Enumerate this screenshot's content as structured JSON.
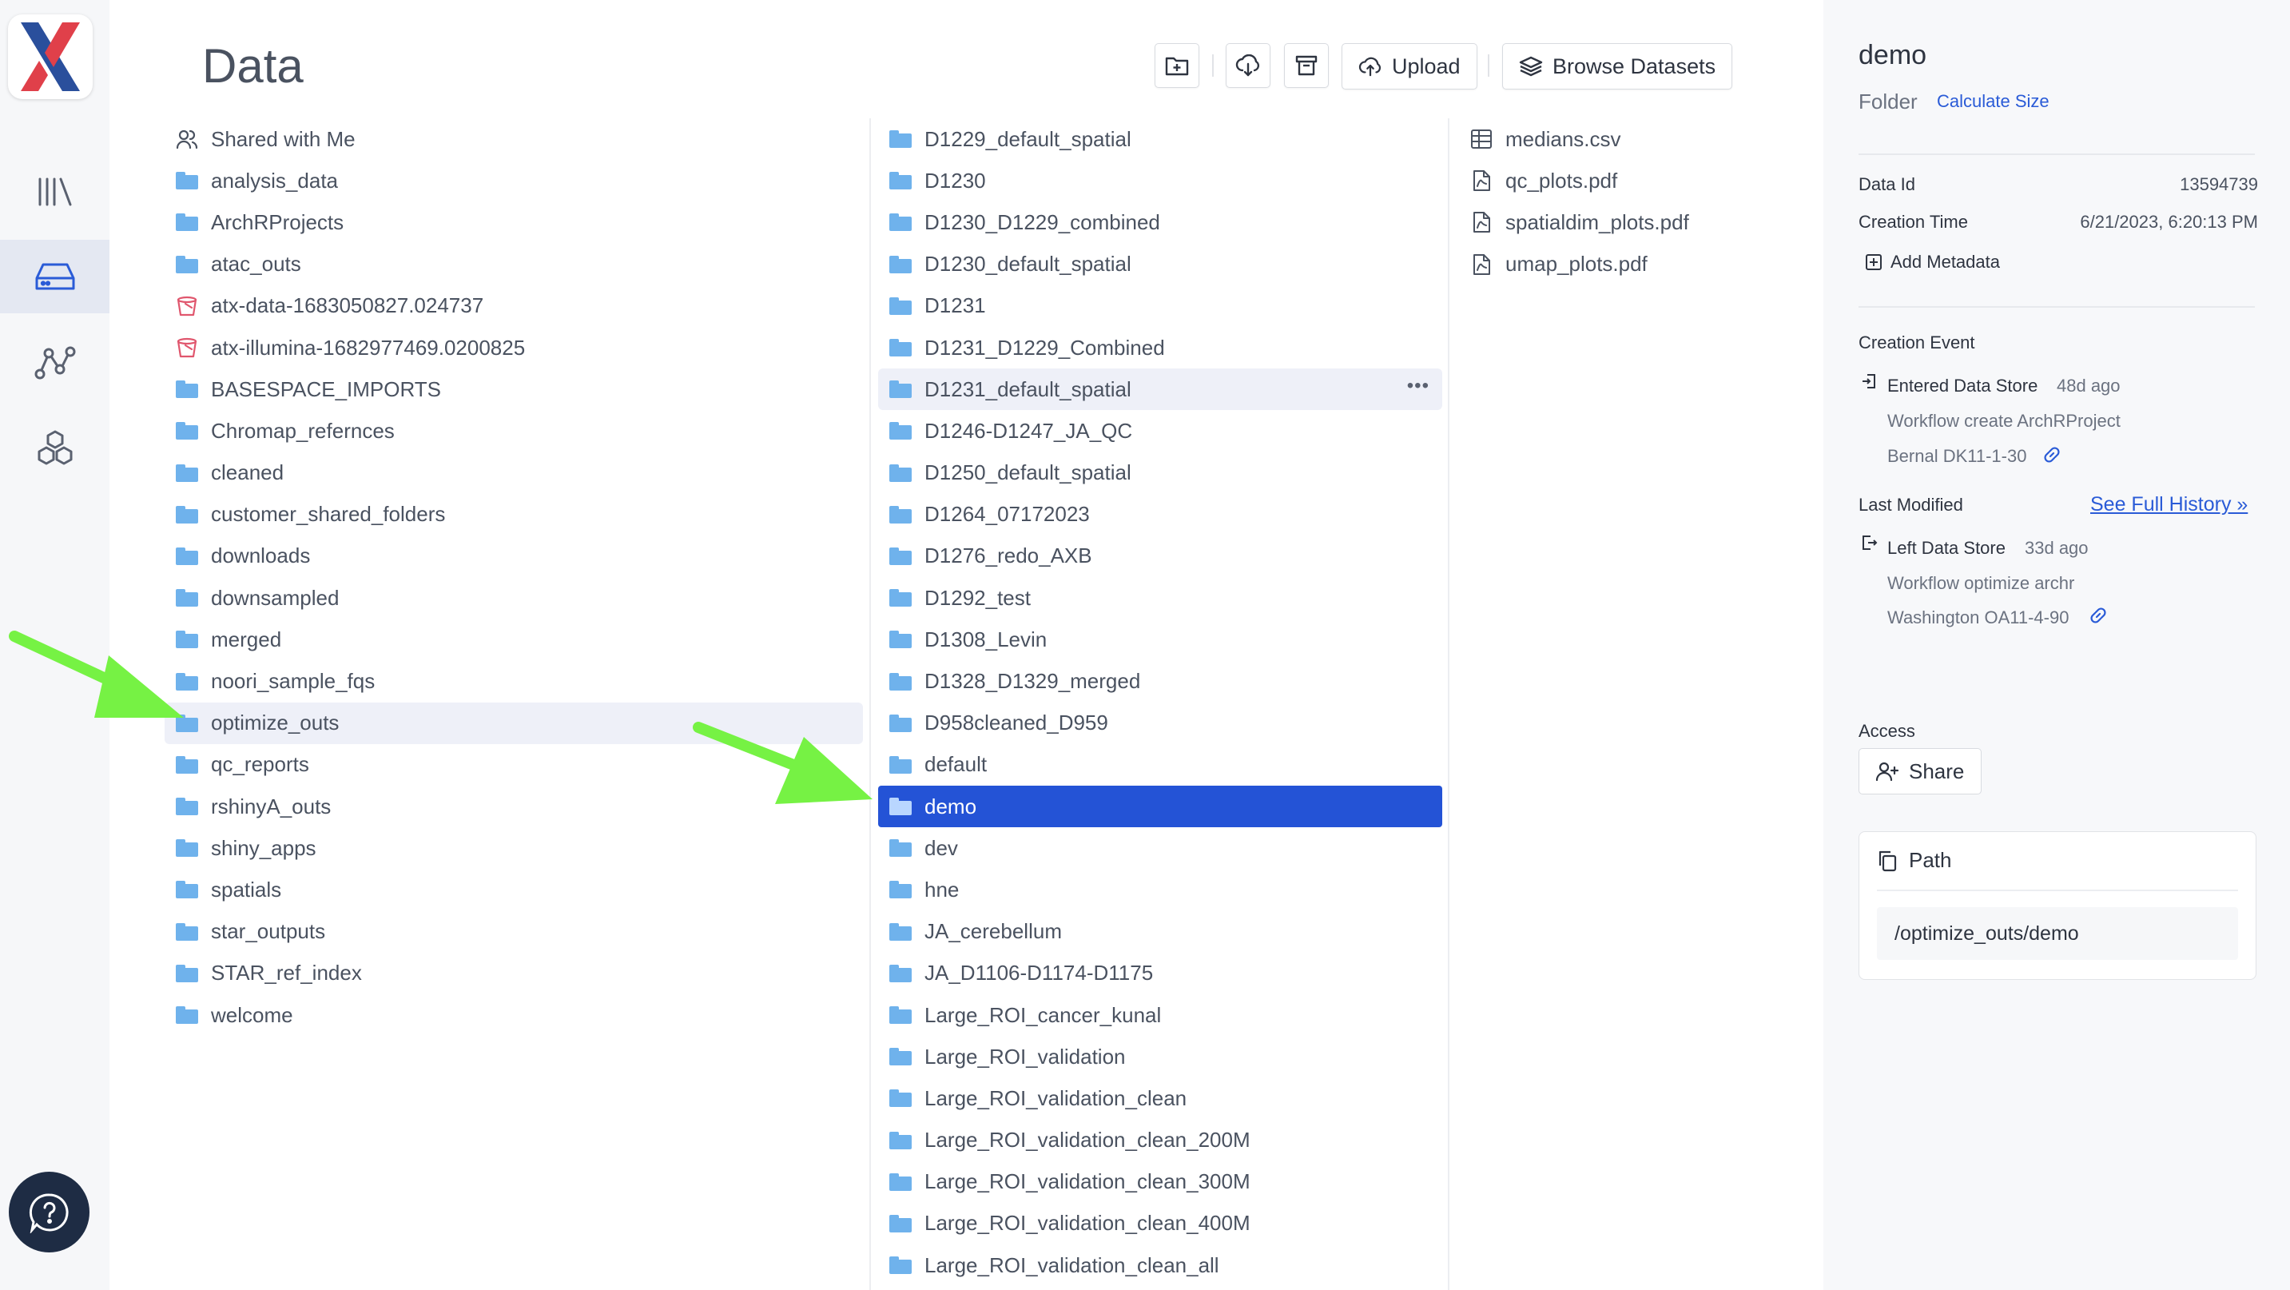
{
  "app": {
    "logo_name": "LatchBio X"
  },
  "nav": {
    "items": [
      {
        "icon": "library-icon"
      },
      {
        "icon": "data-drive-icon",
        "active": true
      },
      {
        "icon": "workflow-graph-icon"
      },
      {
        "icon": "hexagons-icon"
      }
    ],
    "help_icon": "help-chat-icon"
  },
  "header": {
    "title": "Data",
    "upload_label": "Upload",
    "browse_label": "Browse Datasets"
  },
  "column1": [
    {
      "name": "Shared with Me",
      "icon": "shared-users-icon"
    },
    {
      "name": "analysis_data",
      "icon": "folder-icon"
    },
    {
      "name": "ArchRProjects",
      "icon": "folder-icon"
    },
    {
      "name": "atac_outs",
      "icon": "folder-icon"
    },
    {
      "name": "atx-data-1683050827.024737",
      "icon": "bucket-icon"
    },
    {
      "name": "atx-illumina-1682977469.0200825",
      "icon": "bucket-icon"
    },
    {
      "name": "BASESPACE_IMPORTS",
      "icon": "folder-icon"
    },
    {
      "name": "Chromap_refernces",
      "icon": "folder-icon"
    },
    {
      "name": "cleaned",
      "icon": "folder-icon"
    },
    {
      "name": "customer_shared_folders",
      "icon": "folder-icon"
    },
    {
      "name": "downloads",
      "icon": "folder-icon"
    },
    {
      "name": "downsampled",
      "icon": "folder-icon"
    },
    {
      "name": "merged",
      "icon": "folder-icon"
    },
    {
      "name": "noori_sample_fqs",
      "icon": "folder-icon"
    },
    {
      "name": "optimize_outs",
      "icon": "folder-icon",
      "state": "hover"
    },
    {
      "name": "qc_reports",
      "icon": "folder-icon"
    },
    {
      "name": "rshinyA_outs",
      "icon": "folder-icon"
    },
    {
      "name": "shiny_apps",
      "icon": "folder-icon"
    },
    {
      "name": "spatials",
      "icon": "folder-icon"
    },
    {
      "name": "star_outputs",
      "icon": "folder-icon"
    },
    {
      "name": "STAR_ref_index",
      "icon": "folder-icon"
    },
    {
      "name": "welcome",
      "icon": "folder-icon"
    }
  ],
  "column2": [
    {
      "name": "D1229_default_spatial"
    },
    {
      "name": "D1230"
    },
    {
      "name": "D1230_D1229_combined"
    },
    {
      "name": "D1230_default_spatial"
    },
    {
      "name": "D1231"
    },
    {
      "name": "D1231_D1229_Combined"
    },
    {
      "name": "D1231_default_spatial",
      "state": "hover"
    },
    {
      "name": "D1246-D1247_JA_QC"
    },
    {
      "name": "D1250_default_spatial"
    },
    {
      "name": "D1264_07172023"
    },
    {
      "name": "D1276_redo_AXB"
    },
    {
      "name": "D1292_test"
    },
    {
      "name": "D1308_Levin"
    },
    {
      "name": "D1328_D1329_merged"
    },
    {
      "name": "D958cleaned_D959"
    },
    {
      "name": "default"
    },
    {
      "name": "demo",
      "state": "selected"
    },
    {
      "name": "dev"
    },
    {
      "name": "hne"
    },
    {
      "name": "JA_cerebellum"
    },
    {
      "name": "JA_D1106-D1174-D1175"
    },
    {
      "name": "Large_ROI_cancer_kunal"
    },
    {
      "name": "Large_ROI_validation"
    },
    {
      "name": "Large_ROI_validation_clean"
    },
    {
      "name": "Large_ROI_validation_clean_200M"
    },
    {
      "name": "Large_ROI_validation_clean_300M"
    },
    {
      "name": "Large_ROI_validation_clean_400M"
    },
    {
      "name": "Large_ROI_validation_clean_all"
    }
  ],
  "column3": [
    {
      "name": "medians.csv",
      "icon": "table-icon"
    },
    {
      "name": "qc_plots.pdf",
      "icon": "pdf-icon"
    },
    {
      "name": "spatialdim_plots.pdf",
      "icon": "pdf-icon"
    },
    {
      "name": "umap_plots.pdf",
      "icon": "pdf-icon"
    }
  ],
  "details": {
    "title": "demo",
    "type": "Folder",
    "calc_link": "Calculate Size",
    "data_id_label": "Data Id",
    "data_id": "13594739",
    "creation_time_label": "Creation Time",
    "creation_time": "6/21/2023, 6:20:13 PM",
    "add_metadata": "Add Metadata",
    "creation_event_label": "Creation Event",
    "creation_event": {
      "action": "Entered Data Store",
      "ago": "48d ago",
      "workflow": "Workflow create ArchRProject",
      "run": "Bernal DK11-1-30"
    },
    "last_modified_label": "Last Modified",
    "full_history_link": "See Full History »",
    "last_modified": {
      "action": "Left Data Store",
      "ago": "33d ago",
      "workflow": "Workflow optimize archr",
      "run": "Washington OA11-4-90"
    },
    "access_label": "Access",
    "share_label": "Share",
    "path_label": "Path",
    "path": "/optimize_outs/demo"
  },
  "colors": {
    "accent": "#2453d6",
    "folder": "#6fb2ec",
    "bucket": "#e0566d",
    "annotation_arrow": "#76f244",
    "link": "#2a5bd7"
  }
}
